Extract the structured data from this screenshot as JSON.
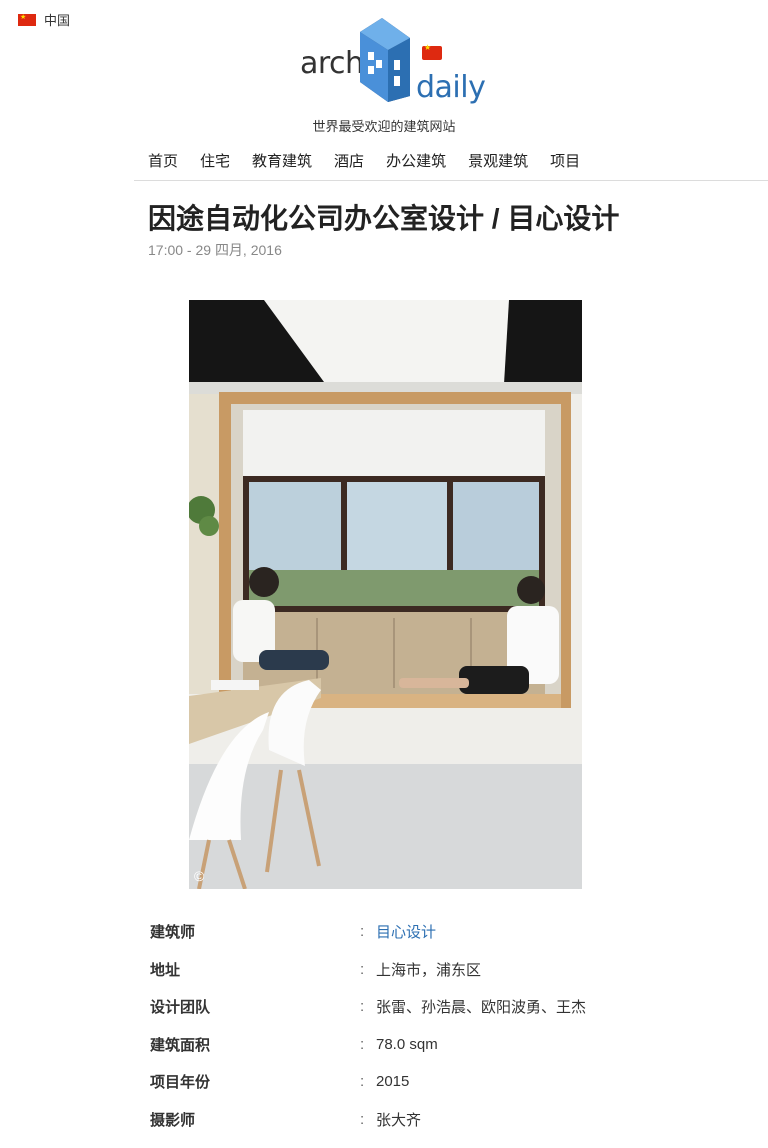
{
  "locale": {
    "label": "中国"
  },
  "logo": {
    "word1": "arch",
    "word2": "daily"
  },
  "tagline": "世界最受欢迎的建筑网站",
  "nav": {
    "items": [
      {
        "label": "首页"
      },
      {
        "label": "住宅"
      },
      {
        "label": "教育建筑"
      },
      {
        "label": "酒店"
      },
      {
        "label": "办公建筑"
      },
      {
        "label": "景观建筑"
      },
      {
        "label": "项目"
      }
    ]
  },
  "article": {
    "title": "因途自动化公司办公室设计 / 目心设计",
    "date": "17:00 - 29 四月, 2016",
    "photo_copyright": "©"
  },
  "details": [
    {
      "label": "建筑师",
      "value": "目心设计",
      "link": true
    },
    {
      "label": "地址",
      "value": "上海市，浦东区",
      "link": false
    },
    {
      "label": "设计团队",
      "value": "张雷、孙浩晨、欧阳波勇、王杰",
      "link": false
    },
    {
      "label": "建筑面积",
      "value": "78.0 sqm",
      "link": false
    },
    {
      "label": "项目年份",
      "value": "2015",
      "link": false
    },
    {
      "label": "摄影师",
      "value": "张大齐",
      "link": false
    }
  ],
  "colors": {
    "brand_blue": "#2c6fb2",
    "flag_red": "#de2910"
  }
}
